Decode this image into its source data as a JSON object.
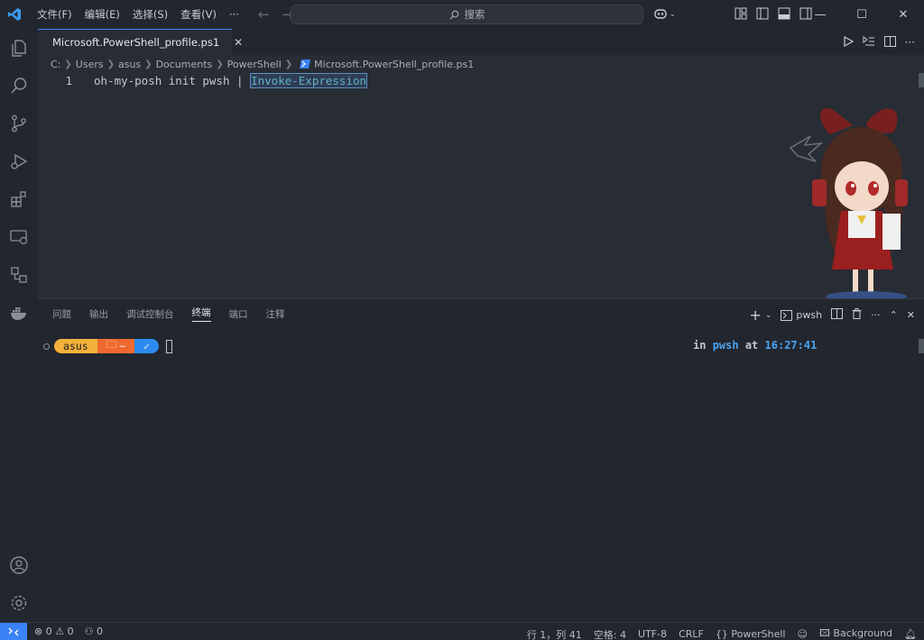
{
  "titlebar": {
    "menus": [
      "文件(F)",
      "编辑(E)",
      "选择(S)",
      "查看(V)",
      "···"
    ],
    "search_placeholder": "搜索"
  },
  "tab": {
    "filename": "Microsoft.PowerShell_profile.ps1"
  },
  "breadcrumb": [
    "C:",
    "Users",
    "asus",
    "Documents",
    "PowerShell",
    "Microsoft.PowerShell_profile.ps1"
  ],
  "editor": {
    "line_number": "1",
    "code_plain": "oh-my-posh init pwsh | ",
    "code_selected": "Invoke-Expression"
  },
  "panel": {
    "tabs": [
      "问题",
      "输出",
      "调试控制台",
      "终端",
      "端口",
      "注释"
    ],
    "active_tab": "终端",
    "shell_label": "pwsh"
  },
  "terminal": {
    "user": "asus",
    "path": "~",
    "status": "✓",
    "right_in": "in",
    "right_shell": "pwsh",
    "right_at": "at",
    "time": "16:27:41"
  },
  "statusbar": {
    "errors": "0",
    "warnings": "0",
    "ports": "0",
    "position": "行 1，列 41",
    "spaces": "空格: 4",
    "encoding": "UTF-8",
    "eol": "CRLF",
    "language": "PowerShell",
    "background": "Background"
  },
  "colors": {
    "accent": "#3b82f6",
    "prompt_user": "#f3b23a",
    "prompt_path": "#f06a2f",
    "prompt_ok": "#2b8bf0"
  }
}
